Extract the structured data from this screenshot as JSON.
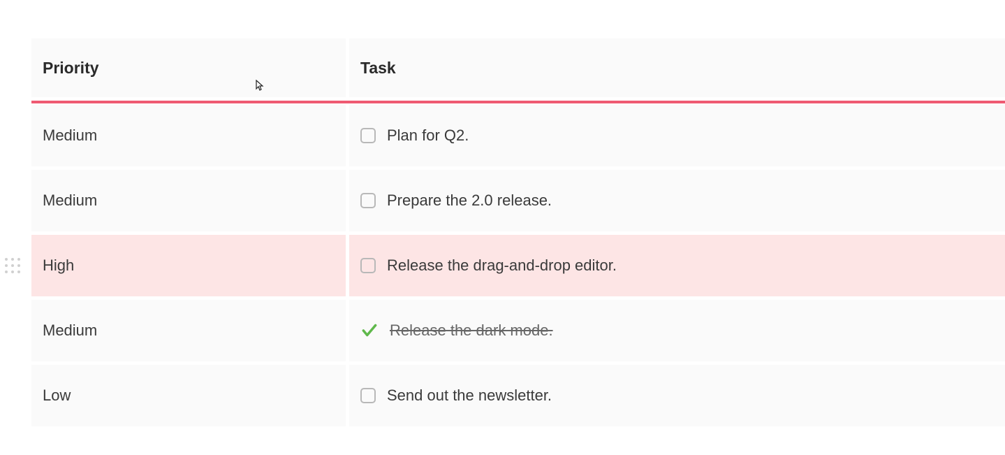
{
  "columns": {
    "priority": "Priority",
    "task": "Task"
  },
  "rows": [
    {
      "priority": "Medium",
      "task": "Plan for Q2.",
      "done": false,
      "highlighted": false,
      "dragHandle": false
    },
    {
      "priority": "Medium",
      "task": "Prepare the 2.0 release.",
      "done": false,
      "highlighted": false,
      "dragHandle": false
    },
    {
      "priority": "High",
      "task": "Release the drag-and-drop editor.",
      "done": false,
      "highlighted": true,
      "dragHandle": true
    },
    {
      "priority": "Medium",
      "task": "Release the dark mode.",
      "done": true,
      "highlighted": false,
      "dragHandle": false
    },
    {
      "priority": "Low",
      "task": "Send out the newsletter.",
      "done": false,
      "highlighted": false,
      "dragHandle": false
    }
  ],
  "colors": {
    "accent": "#ef5a72",
    "highlight": "#fde5e5",
    "check": "#5fb84b"
  }
}
